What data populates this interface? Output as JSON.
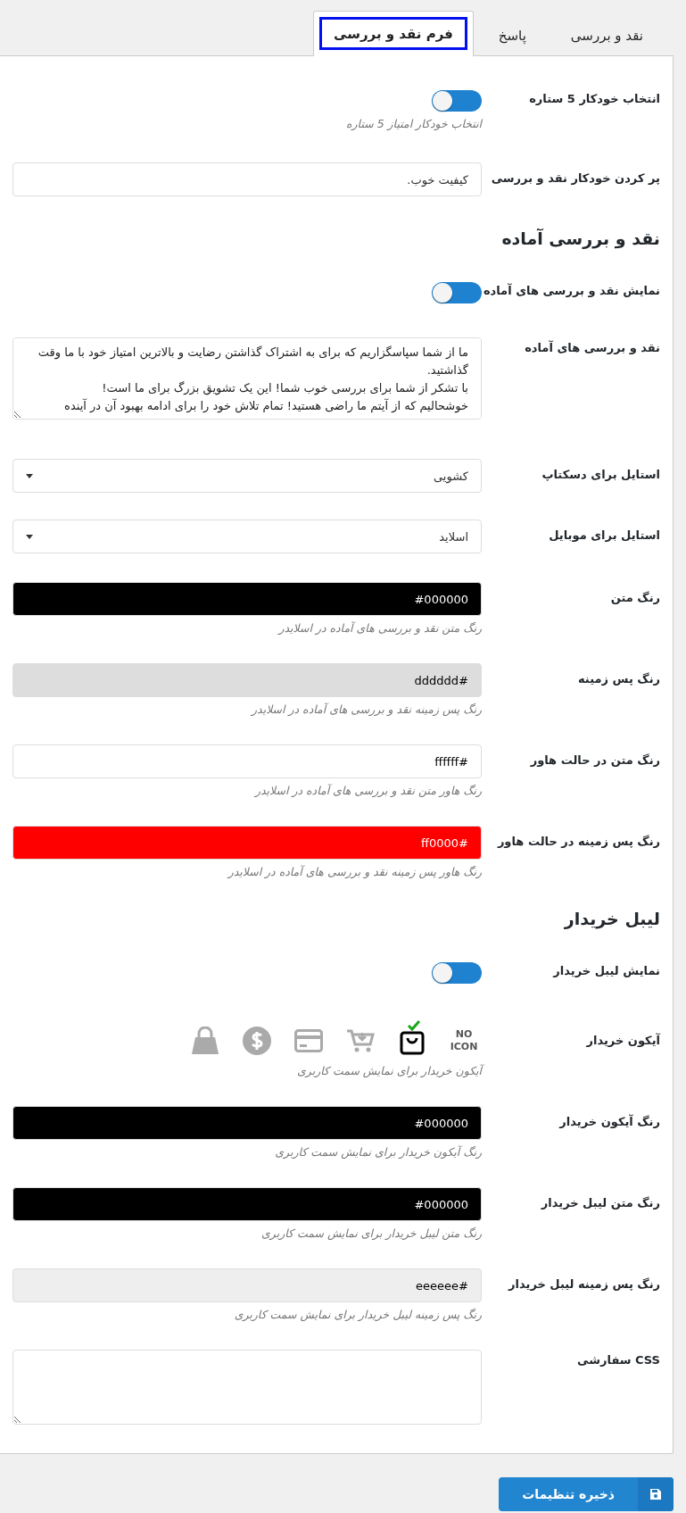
{
  "tabs": [
    {
      "label": "نقد و بررسی",
      "selected": false
    },
    {
      "label": "پاسخ",
      "selected": false
    },
    {
      "label": "فرم نقد و بررسی",
      "selected": true
    }
  ],
  "rows": [
    {
      "kind": "toggle",
      "label": "انتخاب خودکار 5 ستاره",
      "on": false,
      "description": "انتخاب خودکار امتیاز 5 ستاره"
    },
    {
      "kind": "text",
      "label": "پر کردن خودکار نقد و بررسی",
      "value": "کیفیت خوب."
    },
    {
      "kind": "heading",
      "label": "نقد و بررسی آماده"
    },
    {
      "kind": "toggle",
      "label": "نمایش نقد و بررسی های آماده",
      "on": false
    },
    {
      "kind": "textarea",
      "label": "نقد و بررسی های آماده",
      "value": "ما از شما سپاسگزاریم که برای به اشتراک گذاشتن رضایت و بالاترین امتیاز خود با ما وقت گذاشتید.\nبا تشکر از شما برای بررسی خوب شما! این یک تشویق بزرگ برای ما است!\nخوشحالیم که از آیتم ما راضی هستید! تمام تلاش خود را برای ادامه بهبود آن در آینده"
    },
    {
      "kind": "select",
      "label": "استایل برای دسکتاپ",
      "value": "کشویی"
    },
    {
      "kind": "select",
      "label": "استایل برای موبایل",
      "value": "اسلاید"
    },
    {
      "kind": "color",
      "label": "رنگ متن",
      "value": "#000000",
      "description": "رنگ متن نقد و بررسی های آماده در اسلایدر"
    },
    {
      "kind": "color",
      "label": "رنگ پس زمینه",
      "value": "#dddddd",
      "description": "رنگ پس زمینه نقد و بررسی های آماده در اسلایدر"
    },
    {
      "kind": "color",
      "label": "رنگ متن در حالت هاور",
      "value": "#ffffff",
      "description": "رنگ هاور متن نقد و بررسی های آماده در اسلایدر"
    },
    {
      "kind": "color",
      "label": "رنگ پس زمینه در حالت هاور",
      "value": "#ff0000",
      "description": "رنگ هاور پس زمینه نقد و بررسی های آماده در اسلایدر"
    },
    {
      "kind": "heading",
      "label": "لیبل خریدار"
    },
    {
      "kind": "toggle",
      "label": "نمایش لیبل خریدار",
      "on": false
    },
    {
      "kind": "icons",
      "label": "آیکون خریدار",
      "description": "آیکون خریدار برای نمایش سمت کاربری",
      "options": [
        {
          "kind": "none",
          "text": "NO ICON",
          "selected": false
        },
        {
          "kind": "bag",
          "selected": true
        },
        {
          "kind": "cart",
          "selected": false
        },
        {
          "kind": "card",
          "selected": false
        },
        {
          "kind": "dollar",
          "selected": false
        },
        {
          "kind": "lock",
          "selected": false
        }
      ]
    },
    {
      "kind": "color",
      "label": "رنگ آیکون خریدار",
      "value": "#000000",
      "description": "رنگ آیکون خریدار برای نمایش سمت کاربری"
    },
    {
      "kind": "color",
      "label": "رنگ متن لیبل خریدار",
      "value": "#000000",
      "description": "رنگ متن لیبل خریدار برای نمایش سمت کاربری"
    },
    {
      "kind": "color",
      "label": "رنگ پس زمینه لیبل خریدار",
      "value": "#eeeeee",
      "description": "رنگ پس زمینه لیبل خریدار برای نمایش سمت کاربری"
    },
    {
      "kind": "textarea",
      "label": "CSS سفارشی",
      "value": ""
    }
  ],
  "save_button": "ذخیره تنظیمات"
}
